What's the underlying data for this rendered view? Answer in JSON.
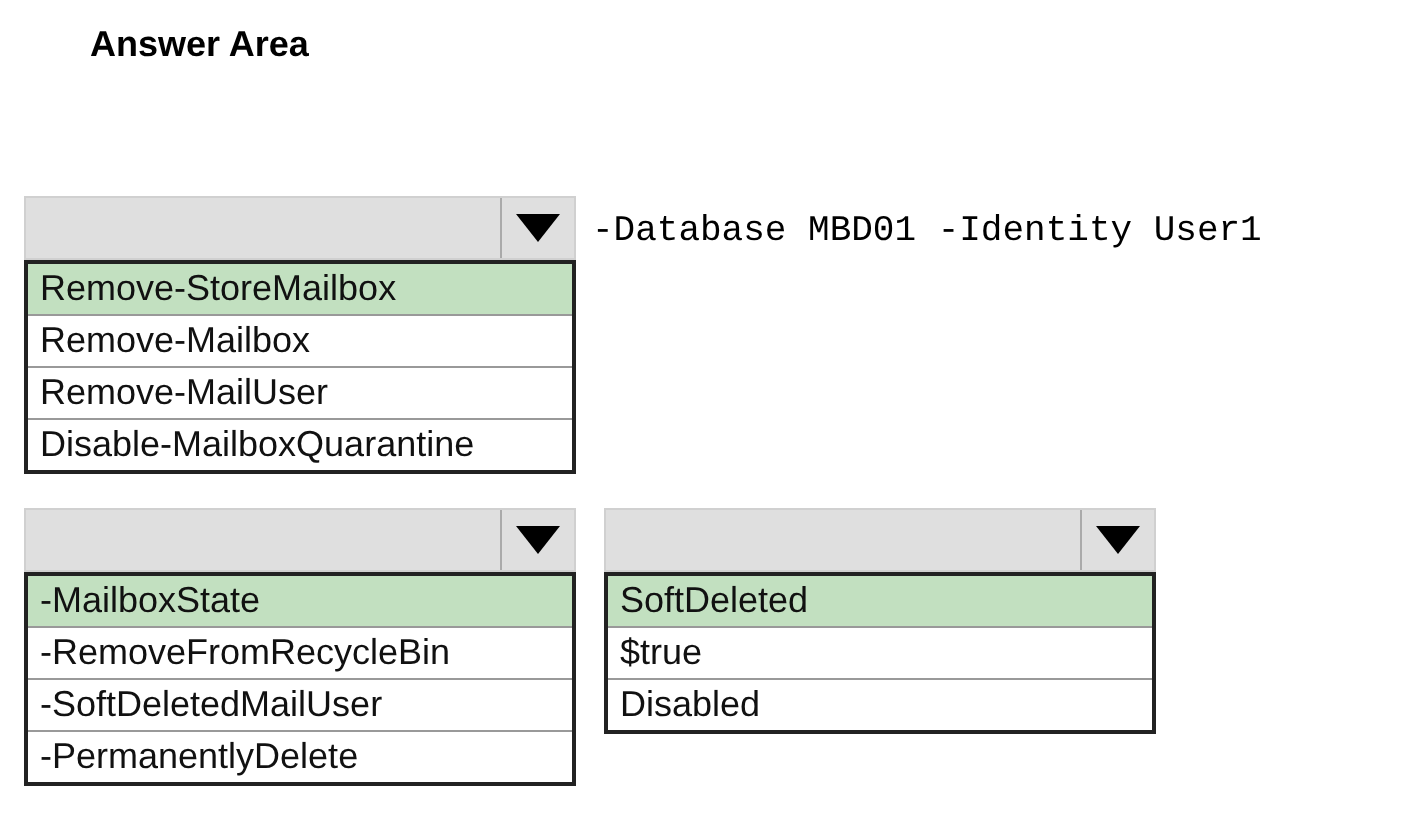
{
  "title": "Answer Area",
  "rows": [
    {
      "dropdowns": [
        {
          "options": [
            {
              "label": "Remove-StoreMailbox",
              "selected": true
            },
            {
              "label": "Remove-Mailbox",
              "selected": false
            },
            {
              "label": "Remove-MailUser",
              "selected": false
            },
            {
              "label": "Disable-MailboxQuarantine",
              "selected": false
            }
          ]
        }
      ],
      "code": "-Database MBD01 -Identity User1"
    },
    {
      "dropdowns": [
        {
          "options": [
            {
              "label": "-MailboxState",
              "selected": true
            },
            {
              "label": "-RemoveFromRecycleBin",
              "selected": false
            },
            {
              "label": "-SoftDeletedMailUser",
              "selected": false
            },
            {
              "label": "-PermanentlyDelete",
              "selected": false
            }
          ]
        },
        {
          "options": [
            {
              "label": "SoftDeleted",
              "selected": true
            },
            {
              "label": "$true",
              "selected": false
            },
            {
              "label": "Disabled",
              "selected": false
            }
          ]
        }
      ]
    }
  ]
}
